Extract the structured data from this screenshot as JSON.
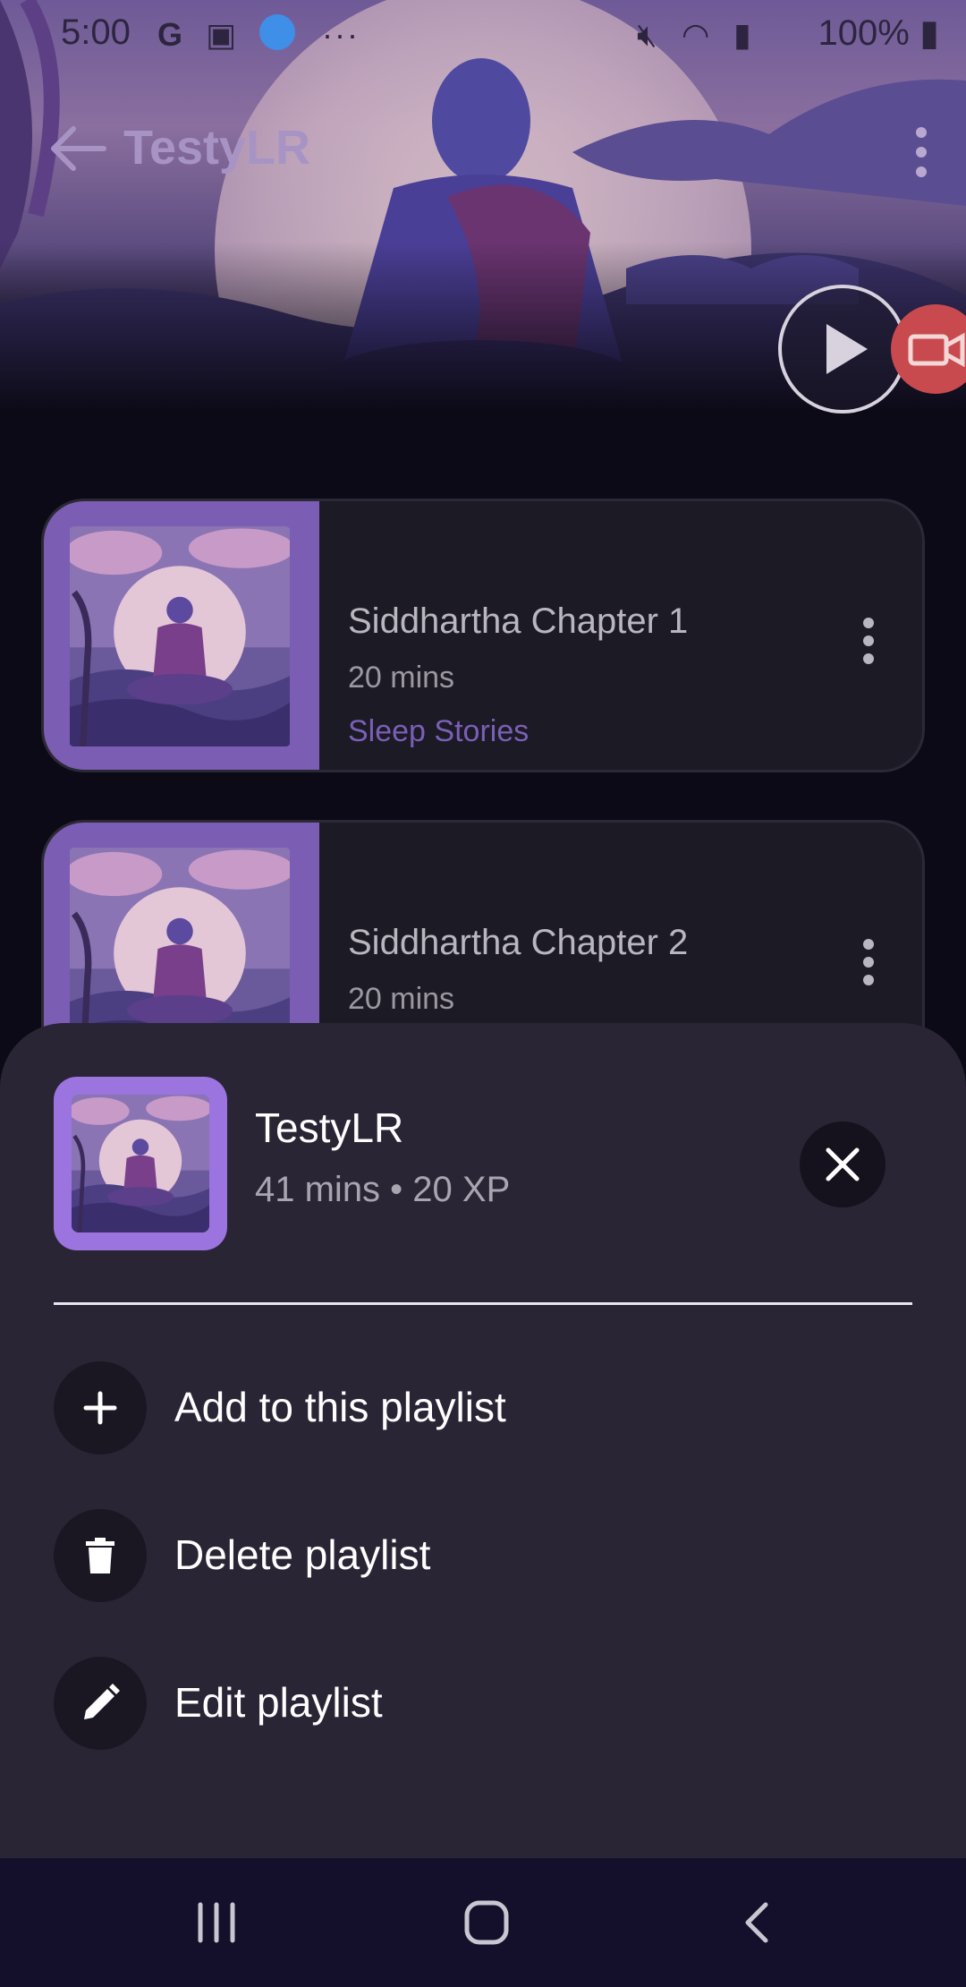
{
  "status_bar": {
    "time": "5:00",
    "battery": "100%",
    "icons": [
      "google-icon",
      "teams-icon",
      "app-icon",
      "more-dots-icon",
      "mute-icon",
      "wifi-icon",
      "signal-icon",
      "battery-icon"
    ]
  },
  "header": {
    "title": "TestyLR"
  },
  "tracks": [
    {
      "name": "Siddhartha Chapter 1",
      "duration": "20 mins",
      "category": "Sleep Stories"
    },
    {
      "name": "Siddhartha Chapter 2",
      "duration": "20 mins",
      "category": ""
    }
  ],
  "sheet": {
    "playlist_name": "TestyLR",
    "meta": "41 mins • 20 XP",
    "actions": [
      {
        "label": "Add to this playlist",
        "icon": "plus-icon"
      },
      {
        "label": "Delete playlist",
        "icon": "trash-icon"
      },
      {
        "label": "Edit playlist",
        "icon": "pencil-icon"
      }
    ]
  },
  "colors": {
    "accent": "#7a5fb7",
    "sheet_bg": "#2a2535",
    "record": "#c84a4f"
  }
}
